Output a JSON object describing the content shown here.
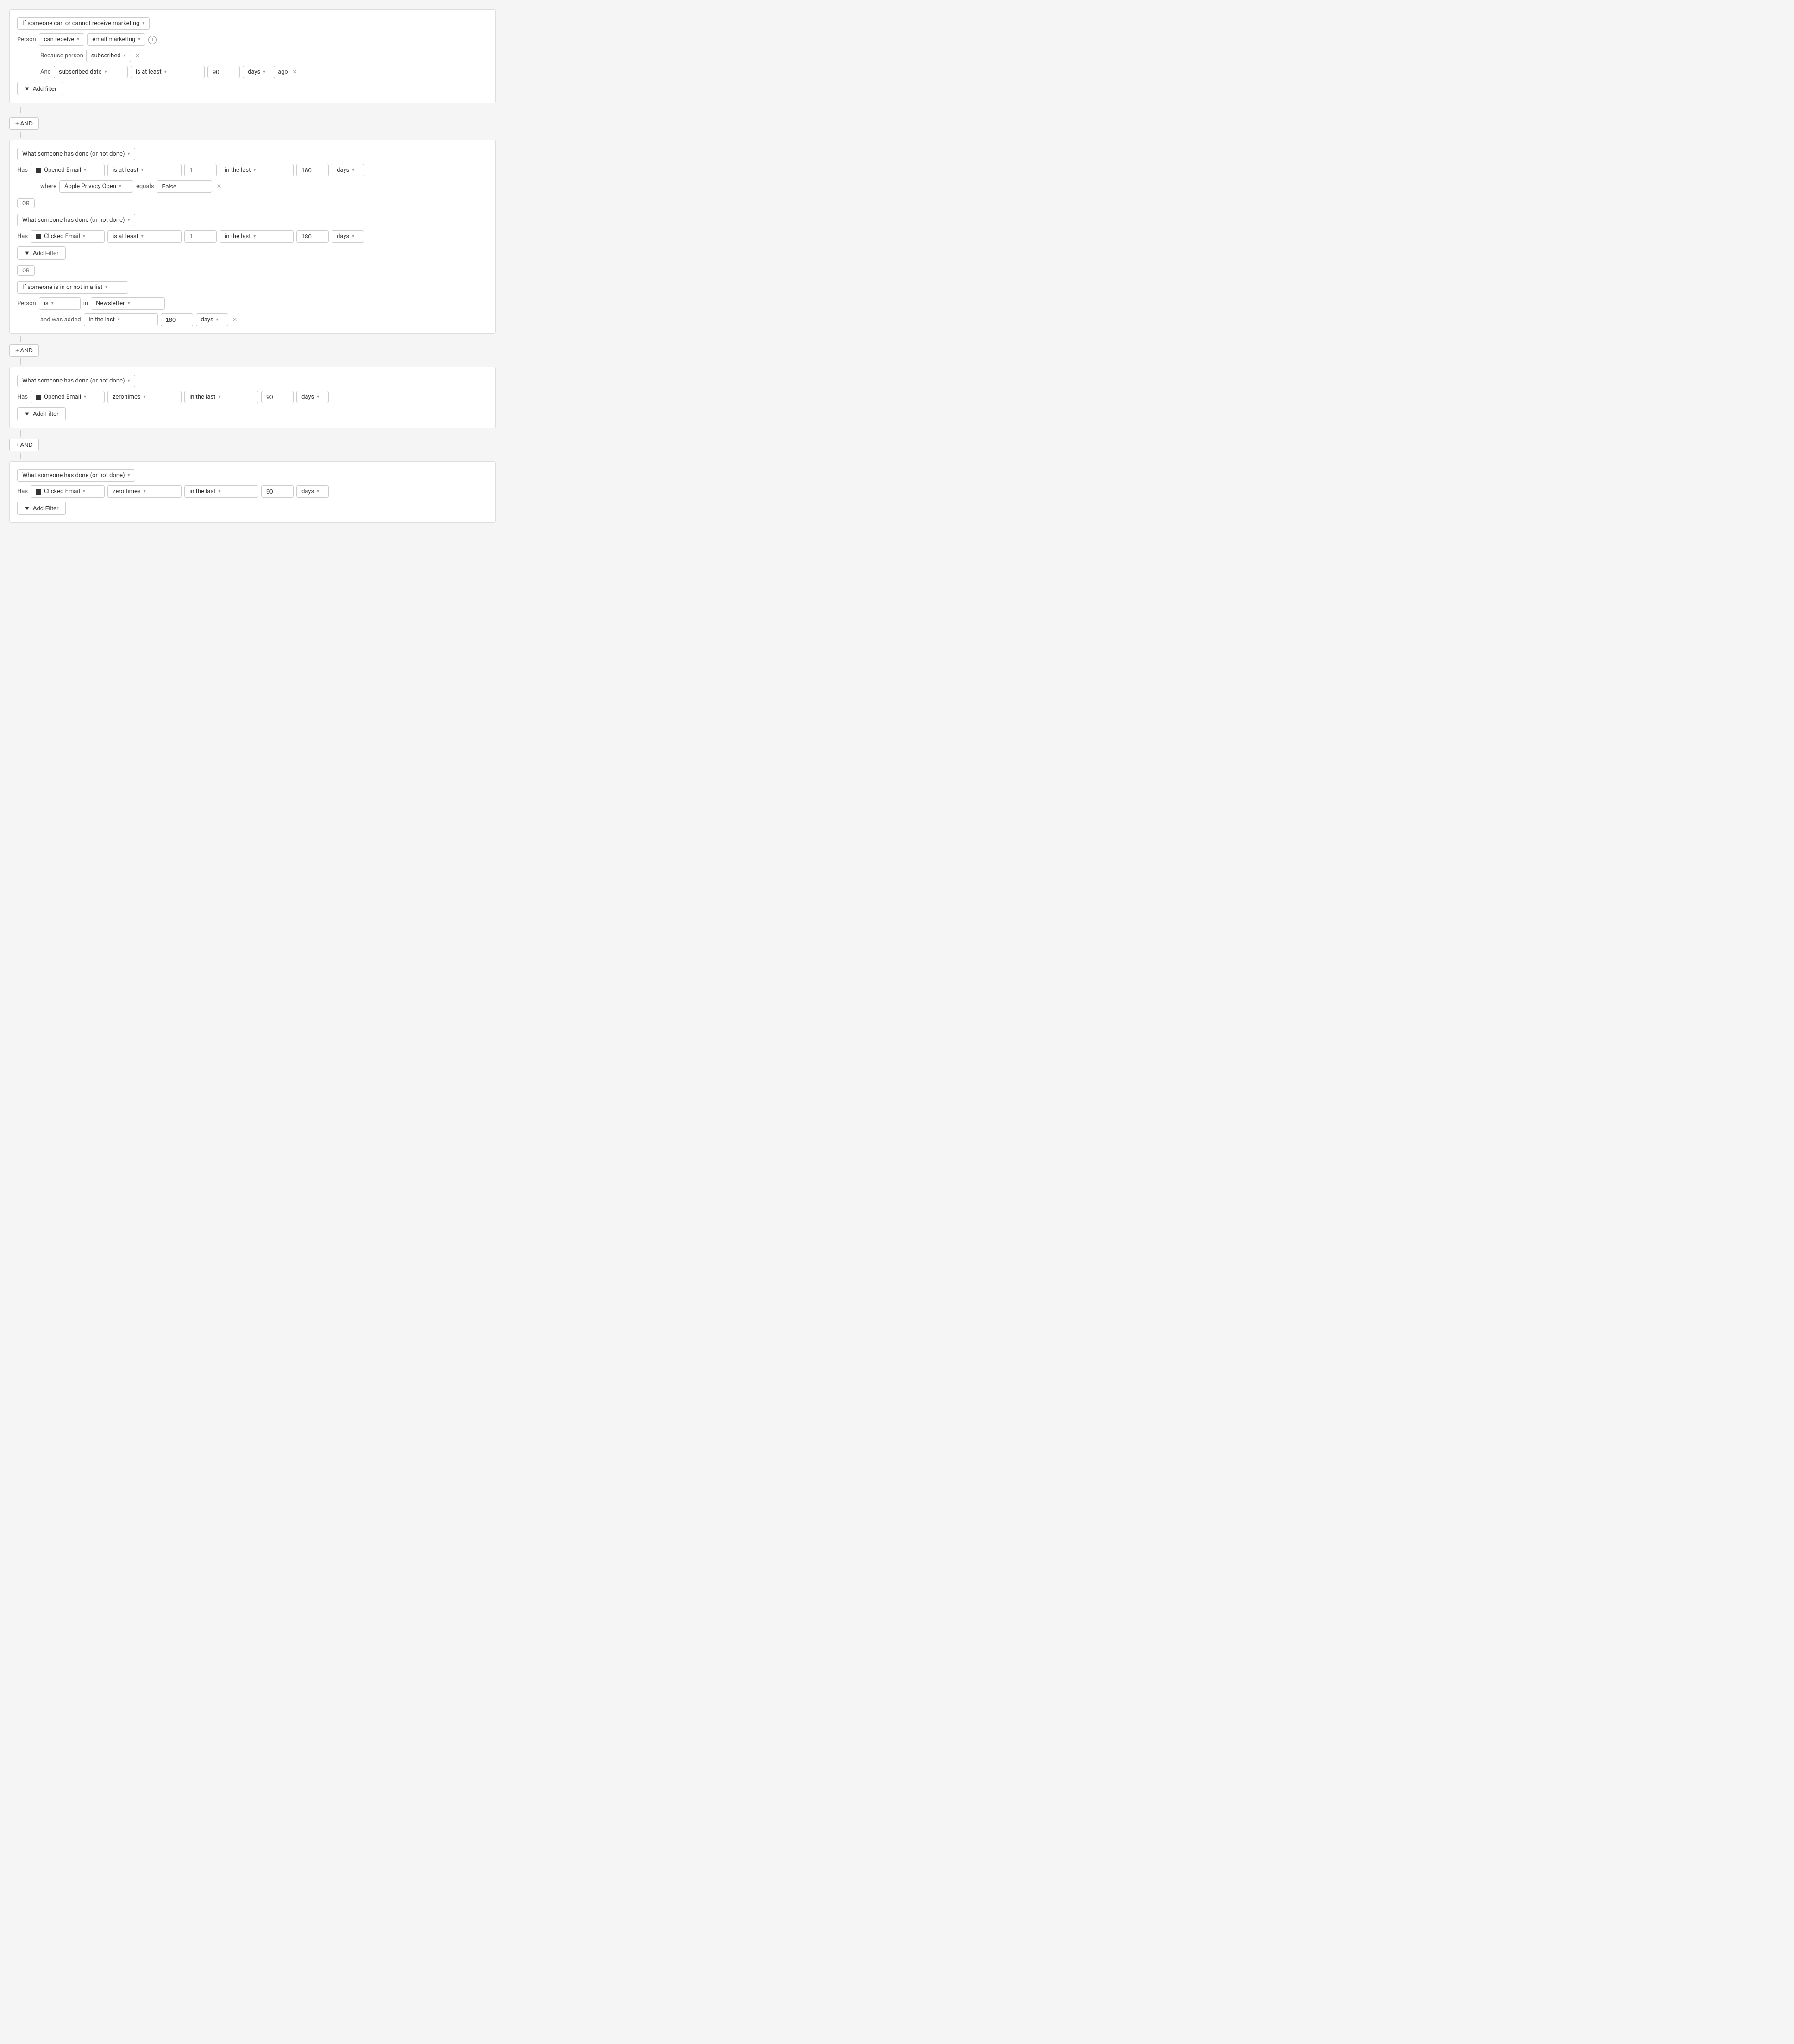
{
  "blocks": [
    {
      "id": "block1",
      "type": "marketing",
      "main_dropdown": "If someone can or cannot receive marketing",
      "person_label": "Person",
      "person_condition": "can receive",
      "person_channel": "email marketing",
      "because_label": "Because person",
      "because_value": "subscribed",
      "and_label": "And",
      "and_field": "subscribed date",
      "and_operator": "is at least",
      "and_value": "90",
      "and_unit": "days",
      "and_suffix": "ago"
    },
    {
      "id": "block2",
      "type": "has_done",
      "sections": [
        {
          "id": "section1",
          "condition_dropdown": "What someone has done (or not done)",
          "has_label": "Has",
          "event": "Opened Email",
          "operator": "is at least",
          "value": "1",
          "time_operator": "in the last",
          "time_value": "180",
          "time_unit": "days",
          "where_label": "where",
          "where_field": "Apple Privacy Open",
          "where_op": "equals",
          "where_value": "False"
        },
        {
          "id": "section2",
          "condition_dropdown": "What someone has done (or not done)",
          "has_label": "Has",
          "event": "Clicked Email",
          "operator": "is at least",
          "value": "1",
          "time_operator": "in the last",
          "time_value": "180",
          "time_unit": "days",
          "add_filter_label": "Add Filter"
        },
        {
          "id": "section3",
          "type": "list",
          "condition_dropdown": "If someone is in or not in a list",
          "person_label": "Person",
          "person_op": "is",
          "list_prep": "in",
          "list_value": "Newsletter",
          "was_added_label": "and was added",
          "was_added_op": "in the last",
          "was_added_value": "180",
          "was_added_unit": "days"
        }
      ],
      "add_filter_label": "Add Filter"
    },
    {
      "id": "block3",
      "type": "has_done",
      "condition_dropdown": "What someone has done (or not done)",
      "has_label": "Has",
      "event": "Opened Email",
      "operator": "zero times",
      "time_operator": "in the last",
      "time_value": "90",
      "time_unit": "days",
      "add_filter_label": "Add Filter"
    },
    {
      "id": "block4",
      "type": "has_done",
      "condition_dropdown": "What someone has done (or not done)",
      "has_label": "Has",
      "event": "Clicked Email",
      "operator": "zero times",
      "time_operator": "in the last",
      "time_value": "90",
      "time_unit": "days",
      "add_filter_label": "Add Filter"
    }
  ],
  "connectors": {
    "and_label": "+ AND",
    "or_label": "OR"
  },
  "icons": {
    "dropdown_arrow": "▾",
    "close": "×",
    "filter": "▼",
    "plus": "+"
  }
}
